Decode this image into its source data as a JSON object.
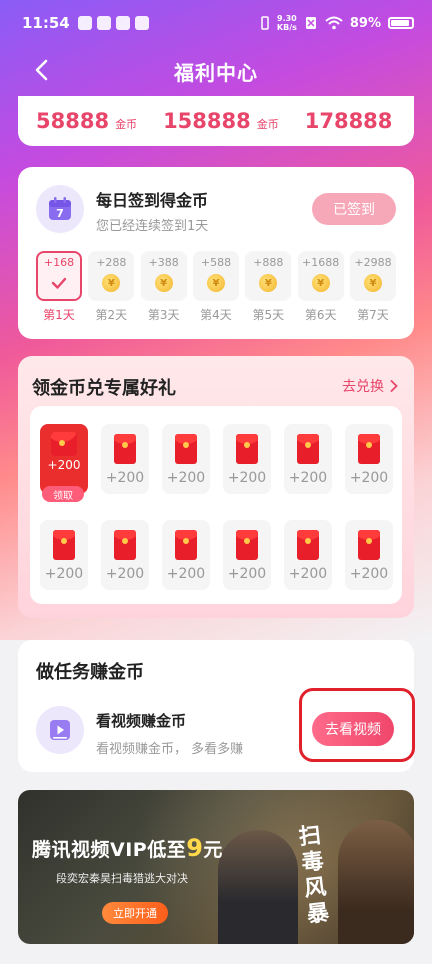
{
  "status_bar": {
    "time": "11:54",
    "net_speed_top": "9.30",
    "net_speed_bottom": "KB/s",
    "battery": "89%"
  },
  "header": {
    "title": "福利中心"
  },
  "coin_strip": {
    "items": [
      {
        "amount": "58888",
        "unit": "金币"
      },
      {
        "amount": "158888",
        "unit": "金币"
      },
      {
        "amount": "178888",
        "unit": ""
      }
    ]
  },
  "checkin": {
    "title": "每日签到得金币",
    "subtitle": "您已经连续签到1天",
    "button_label": "已签到",
    "calendar_day": "7",
    "days": [
      {
        "amount": "+168",
        "label": "第1天",
        "checked": true
      },
      {
        "amount": "+288",
        "label": "第2天",
        "checked": false
      },
      {
        "amount": "+388",
        "label": "第3天",
        "checked": false
      },
      {
        "amount": "+588",
        "label": "第4天",
        "checked": false
      },
      {
        "amount": "+888",
        "label": "第5天",
        "checked": false
      },
      {
        "amount": "+1688",
        "label": "第6天",
        "checked": false
      },
      {
        "amount": "+2988",
        "label": "第7天",
        "checked": false
      }
    ]
  },
  "gift": {
    "title": "领金币兑专属好礼",
    "link_label": "去兑换",
    "claim_label": "领取",
    "tiles": [
      {
        "amount": "+200",
        "active": true
      },
      {
        "amount": "+200",
        "active": false
      },
      {
        "amount": "+200",
        "active": false
      },
      {
        "amount": "+200",
        "active": false
      },
      {
        "amount": "+200",
        "active": false
      },
      {
        "amount": "+200",
        "active": false
      },
      {
        "amount": "+200",
        "active": false
      },
      {
        "amount": "+200",
        "active": false
      },
      {
        "amount": "+200",
        "active": false
      },
      {
        "amount": "+200",
        "active": false
      },
      {
        "amount": "+200",
        "active": false
      },
      {
        "amount": "+200",
        "active": false
      }
    ]
  },
  "tasks": {
    "title": "做任务赚金币",
    "items": [
      {
        "name": "看视频赚金币",
        "description": "看视频赚金币， 多看多赚",
        "button_label": "去看视频"
      }
    ]
  },
  "banner": {
    "title_prefix": "腾讯视频VIP低至",
    "title_price": "9",
    "title_suffix": "元",
    "subtitle": "段奕宏秦昊扫毒猎逃大对决",
    "button_label": "立即开通",
    "vertical_text": "扫毒风暴"
  },
  "colors": {
    "accent": "#e8456a",
    "highlight_border": "#e0202a"
  }
}
